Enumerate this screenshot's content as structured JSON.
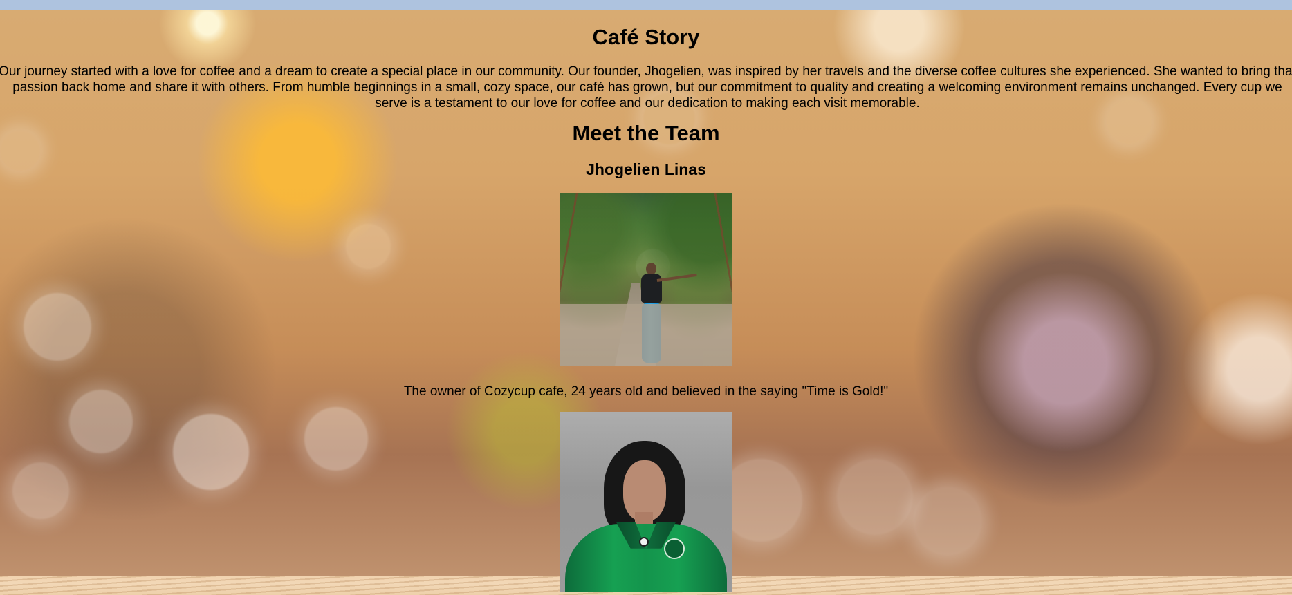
{
  "story": {
    "title": "Café Story",
    "paragraph": "Our journey started with a love for coffee and a dream to create a special place in our community. Our founder, Jhogelien, was inspired by her travels and the diverse coffee cultures she experienced. She wanted to bring that passion back home and share it with others. From humble beginnings in a small, cozy space, our café has grown, but our commitment to quality and creating a welcoming environment remains unchanged. Every cup we serve is a testament to our love for coffee and our dedication to making each visit memorable."
  },
  "team": {
    "title": "Meet the Team",
    "members": [
      {
        "name": "Jhogelien Linas",
        "caption": "The owner of Cozycup cafe, 24 years old and believed in the saying \"Time is Gold!\""
      },
      {}
    ]
  },
  "colors": {
    "top_strip": "#aec3df",
    "text": "#000000"
  }
}
